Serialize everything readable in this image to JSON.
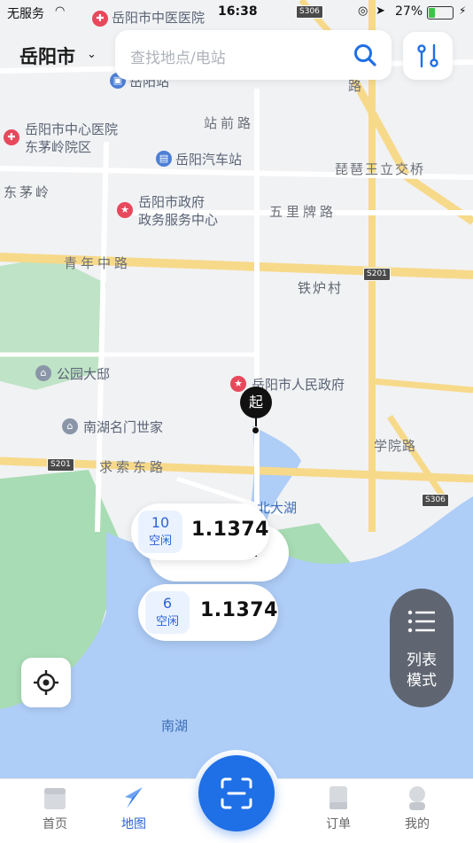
{
  "status_bar": {
    "carrier": "无服务",
    "time": "16:38",
    "battery": "27%"
  },
  "header": {
    "city": "岳阳市",
    "search_placeholder": "查找地点/电站"
  },
  "map": {
    "roads": {
      "zhanqian": "站前路",
      "wuli": "五里牌路",
      "qingnian": "青年中路",
      "qiusuo": "求索东路",
      "pipawang": "琵琶王立交桥",
      "xueyuan": "学院路",
      "road_fragment": "路"
    },
    "places": {
      "zhongyi": "岳阳市中医医院",
      "yueyang_station": "岳阳站",
      "zhongxin_hospital_1": "岳阳市中心医院",
      "zhongxin_hospital_2": "东茅岭院区",
      "qiche_station": "岳阳汽车站",
      "dongmaoling": "东茅岭",
      "gov_service_1": "岳阳市政府",
      "gov_service_2": "政务服务中心",
      "tieluzhen": "铁炉村",
      "gongyuan": "公园大邸",
      "people_gov": "岳阳市人民政府",
      "nanhu_mingmen": "南湖名门世家",
      "beidahu": "北大湖",
      "nanhu": "南湖"
    },
    "shields": {
      "s306": "S306",
      "s201": "S201"
    }
  },
  "stations": [
    {
      "idle_count": "10",
      "idle_label": "空闲",
      "price": "1.1374"
    },
    {
      "idle_count": "6",
      "idle_label": "空闲",
      "price": "1.1374"
    }
  ],
  "start_marker": "起",
  "list_mode": {
    "line1": "列表",
    "line2": "模式"
  },
  "tabs": [
    {
      "label": "首页"
    },
    {
      "label": "地图"
    },
    {
      "label": "订单"
    },
    {
      "label": "我的"
    }
  ],
  "colors": {
    "accent": "#1f6fe6",
    "water": "#aecdf7",
    "park": "#a8dcb4",
    "road": "#f7d98a"
  }
}
